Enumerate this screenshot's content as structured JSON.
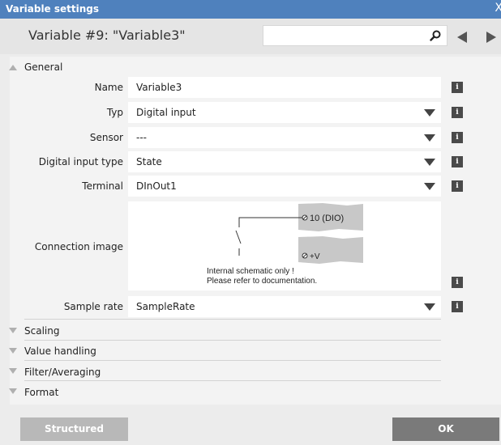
{
  "window": {
    "title": "Variable settings",
    "close_glyph": "X"
  },
  "header": {
    "variable_name": "Variable #9: \"Variable3\"",
    "search_placeholder": ""
  },
  "sections": {
    "general": "General",
    "scaling": "Scaling",
    "value_handling": "Value handling",
    "filter_averaging": "Filter/Averaging",
    "format": "Format"
  },
  "fields": {
    "name": {
      "label": "Name",
      "value": "Variable3"
    },
    "typ": {
      "label": "Typ",
      "value": "Digital input"
    },
    "sensor": {
      "label": "Sensor",
      "value": "---"
    },
    "digital_input_type": {
      "label": "Digital input type",
      "value": "State"
    },
    "terminal": {
      "label": "Terminal",
      "value": "DInOut1"
    },
    "connection_image": {
      "label": "Connection image"
    },
    "sample_rate": {
      "label": "Sample rate",
      "value": "SampleRate"
    }
  },
  "schematic": {
    "pin_top": "10 (DIO)",
    "pin_bottom": "+V",
    "note_line1": "Internal schematic only !",
    "note_line2": "Please refer to documentation."
  },
  "info_glyph": "i",
  "buttons": {
    "structured": "Structured",
    "ok": "OK"
  },
  "icons": [
    "search-icon",
    "prev-arrow-icon",
    "next-arrow-icon",
    "info-icon",
    "collapse-arrow-icon",
    "expand-arrow-icon",
    "dropdown-arrow-icon"
  ]
}
